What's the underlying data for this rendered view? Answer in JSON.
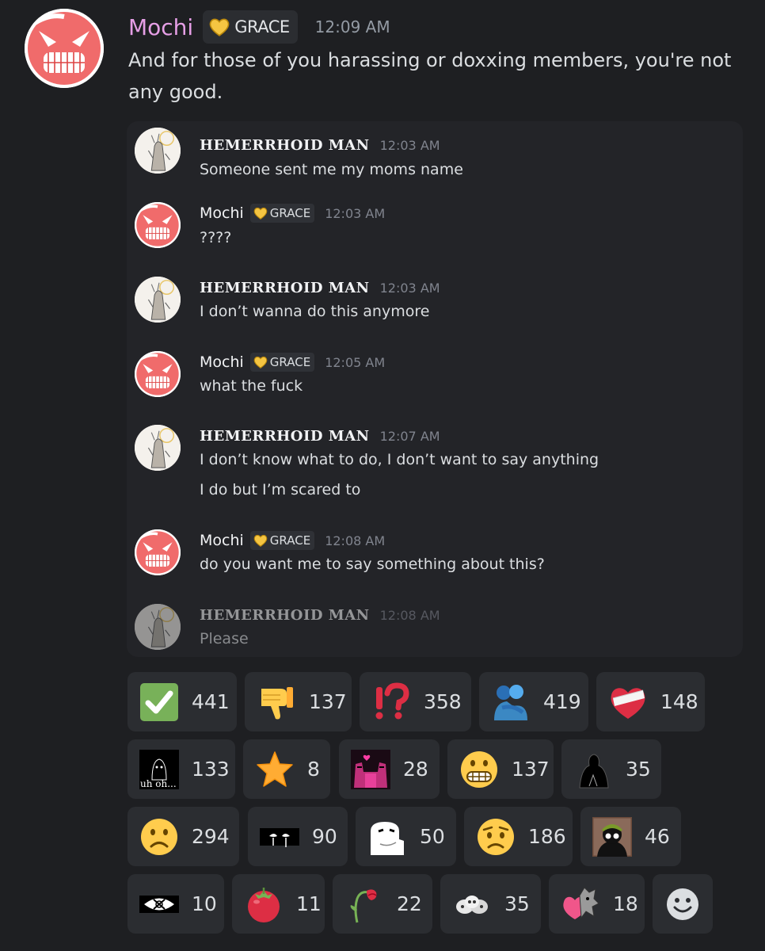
{
  "message": {
    "author": "Mochi",
    "role": "GRACE",
    "timestamp": "12:09 AM",
    "text": "And for those of you harassing or doxxing members, you're not any good."
  },
  "embed": {
    "messages": [
      {
        "author": "HEMERRHOID MAN",
        "time": "12:03 AM",
        "lines": [
          "Someone sent me my moms name"
        ]
      },
      {
        "author": "Mochi",
        "role": "GRACE",
        "time": "12:03 AM",
        "lines": [
          "????"
        ]
      },
      {
        "author": "HEMERRHOID MAN",
        "time": "12:03 AM",
        "lines": [
          "I don’t wanna do this anymore"
        ]
      },
      {
        "author": "Mochi",
        "role": "GRACE",
        "time": "12:05 AM",
        "lines": [
          "what the fuck"
        ]
      },
      {
        "author": "HEMERRHOID MAN",
        "time": "12:07 AM",
        "lines": [
          "I don’t know what to do, I don’t want to say anything",
          "I do but I’m scared to"
        ]
      },
      {
        "author": "Mochi",
        "role": "GRACE",
        "time": "12:08 AM",
        "lines": [
          "do you want me to say something about this?"
        ]
      },
      {
        "author": "HEMERRHOID MAN",
        "time": "12:08 AM",
        "lines": [
          "Please"
        ]
      }
    ]
  },
  "reactions": [
    {
      "icon": "check-mark-icon",
      "count": "441"
    },
    {
      "icon": "thumbs-down-icon",
      "count": "137"
    },
    {
      "icon": "interrobang-icon",
      "count": "358"
    },
    {
      "icon": "people-hugging-icon",
      "count": "419"
    },
    {
      "icon": "mending-heart-icon",
      "count": "148"
    },
    {
      "icon": "uh-oh-custom-emoji-icon",
      "count": "133",
      "caption": "uh oh..."
    },
    {
      "icon": "star-icon",
      "count": "8"
    },
    {
      "icon": "pink-figures-custom-emoji-icon",
      "count": "28"
    },
    {
      "icon": "grimacing-face-icon",
      "count": "137"
    },
    {
      "icon": "shadow-figure-custom-emoji-icon",
      "count": "35"
    },
    {
      "icon": "frowning-face-icon",
      "count": "294"
    },
    {
      "icon": "crying-eyes-custom-emoji-icon",
      "count": "90"
    },
    {
      "icon": "white-ghost-custom-emoji-icon",
      "count": "50"
    },
    {
      "icon": "worried-face-icon",
      "count": "186"
    },
    {
      "icon": "green-hair-figure-custom-emoji-icon",
      "count": "46"
    },
    {
      "icon": "eye-custom-emoji-icon",
      "count": "10"
    },
    {
      "icon": "tomato-icon",
      "count": "11"
    },
    {
      "icon": "wilted-flower-icon",
      "count": "22"
    },
    {
      "icon": "skull-pile-custom-emoji-icon",
      "count": "35"
    },
    {
      "icon": "heart-creature-custom-emoji-icon",
      "count": "18"
    },
    {
      "icon": "add-reaction-icon"
    }
  ],
  "colors": {
    "background": "#1e1f22",
    "embed_background": "#232428",
    "reaction_background": "#2b2d31",
    "author_name": "#e69fe6",
    "timestamp": "#949ba4"
  }
}
